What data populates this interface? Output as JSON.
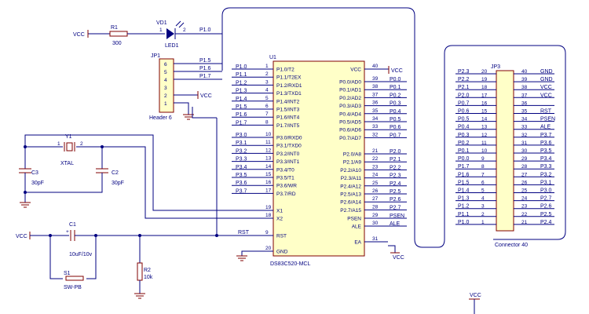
{
  "u1": {
    "ref": "U1",
    "name": "DS83C520-MCL",
    "left_pins": [
      {
        "num": "1",
        "name": "P1.0/T2",
        "net": "P1.0"
      },
      {
        "num": "2",
        "name": "P1.1/T2EX",
        "net": "P1.1"
      },
      {
        "num": "3",
        "name": "P1.2/RXD1",
        "net": "P1.2"
      },
      {
        "num": "4",
        "name": "P1.3/TXD1",
        "net": "P1.3"
      },
      {
        "num": "5",
        "name": "P1.4/INT2",
        "net": "P1.4"
      },
      {
        "num": "6",
        "name": "P1.5/INT3",
        "net": "P1.5"
      },
      {
        "num": "7",
        "name": "P1.6/INT4",
        "net": "P1.6"
      },
      {
        "num": "8",
        "name": "P1.7/INT5",
        "net": "P1.7"
      },
      {
        "num": "10",
        "name": "P3.0/RXD0",
        "net": "P3.0"
      },
      {
        "num": "11",
        "name": "P3.1/TXD0",
        "net": "P3.1"
      },
      {
        "num": "12",
        "name": "P3.2/INT0",
        "net": "P3.2"
      },
      {
        "num": "13",
        "name": "P3.3/INT1",
        "net": "P3.3"
      },
      {
        "num": "14",
        "name": "P3.4/T0",
        "net": "P3.4"
      },
      {
        "num": "15",
        "name": "P3.5/T1",
        "net": "P3.5"
      },
      {
        "num": "16",
        "name": "P3.6/WR",
        "net": "P3.6"
      },
      {
        "num": "17",
        "name": "P3.7/RD",
        "net": "P3.7"
      },
      {
        "num": "19",
        "name": "X1",
        "net": ""
      },
      {
        "num": "18",
        "name": "X2",
        "net": ""
      },
      {
        "num": "9",
        "name": "RST",
        "net": "RST"
      },
      {
        "num": "20",
        "name": "GND",
        "net": ""
      }
    ],
    "right_pins": [
      {
        "num": "40",
        "name": "VCC",
        "net": "VCC"
      },
      {
        "num": "39",
        "name": "P0.0/AD0",
        "net": "P0.0"
      },
      {
        "num": "38",
        "name": "P0.1/AD1",
        "net": "P0.1"
      },
      {
        "num": "37",
        "name": "P0.2/AD2",
        "net": "P0.2"
      },
      {
        "num": "36",
        "name": "P0.3/AD3",
        "net": "P0.3"
      },
      {
        "num": "35",
        "name": "P0.4/AD4",
        "net": "P0.4"
      },
      {
        "num": "34",
        "name": "P0.5/AD5",
        "net": "P0.5"
      },
      {
        "num": "33",
        "name": "P0.6/AD6",
        "net": "P0.6"
      },
      {
        "num": "32",
        "name": "P0.7/AD7",
        "net": "P0.7"
      },
      {
        "num": "21",
        "name": "P2.0/A8",
        "net": "P2.0"
      },
      {
        "num": "22",
        "name": "P2.1/A9",
        "net": "P2.1"
      },
      {
        "num": "23",
        "name": "P2.2/A10",
        "net": "P2.2"
      },
      {
        "num": "24",
        "name": "P2.3/A11",
        "net": "P2.3"
      },
      {
        "num": "25",
        "name": "P2.4/A12",
        "net": "P2.4"
      },
      {
        "num": "26",
        "name": "P2.5/A13",
        "net": "P2.5"
      },
      {
        "num": "27",
        "name": "P2.6/A14",
        "net": "P2.6"
      },
      {
        "num": "28",
        "name": "P2.7/A15",
        "net": "P2.7"
      },
      {
        "num": "29",
        "name": "PSEN",
        "net": "PSEN"
      },
      {
        "num": "30",
        "name": "ALE",
        "net": "ALE"
      },
      {
        "num": "31",
        "name": "EA",
        "net": "VCC"
      }
    ]
  },
  "jp3": {
    "ref": "JP3",
    "name": "Connector 40",
    "rows": [
      {
        "ln": "P2.3",
        "lp": "20",
        "rp": "40",
        "rn": "GND"
      },
      {
        "ln": "P2.2",
        "lp": "19",
        "rp": "39",
        "rn": "GND"
      },
      {
        "ln": "P2.1",
        "lp": "18",
        "rp": "38",
        "rn": "VCC"
      },
      {
        "ln": "P2.0",
        "lp": "17",
        "rp": "37",
        "rn": "VCC"
      },
      {
        "ln": "P0.7",
        "lp": "16",
        "rp": "36",
        "rn": ""
      },
      {
        "ln": "P0.6",
        "lp": "15",
        "rp": "35",
        "rn": "RST"
      },
      {
        "ln": "P0.5",
        "lp": "14",
        "rp": "34",
        "rn": "PSEN"
      },
      {
        "ln": "P0.4",
        "lp": "13",
        "rp": "33",
        "rn": "ALE"
      },
      {
        "ln": "P0.3",
        "lp": "12",
        "rp": "32",
        "rn": "P3.7"
      },
      {
        "ln": "P0.2",
        "lp": "11",
        "rp": "31",
        "rn": "P3.6"
      },
      {
        "ln": "P0.1",
        "lp": "10",
        "rp": "30",
        "rn": "P3.5"
      },
      {
        "ln": "P0.0",
        "lp": "9",
        "rp": "29",
        "rn": "P3.4"
      },
      {
        "ln": "P1.7",
        "lp": "8",
        "rp": "28",
        "rn": "P3.3"
      },
      {
        "ln": "P1.6",
        "lp": "7",
        "rp": "27",
        "rn": "P3.2"
      },
      {
        "ln": "P1.5",
        "lp": "6",
        "rp": "26",
        "rn": "P3.1"
      },
      {
        "ln": "P1.4",
        "lp": "5",
        "rp": "25",
        "rn": "P3.0"
      },
      {
        "ln": "P1.3",
        "lp": "4",
        "rp": "24",
        "rn": "P2.7"
      },
      {
        "ln": "P1.2",
        "lp": "3",
        "rp": "23",
        "rn": "P2.6"
      },
      {
        "ln": "P1.1",
        "lp": "2",
        "rp": "22",
        "rn": "P2.5"
      },
      {
        "ln": "P1.0",
        "lp": "1",
        "rp": "21",
        "rn": "P2.4"
      }
    ]
  },
  "jp1": {
    "ref": "JP1",
    "name": "Header 6",
    "pins": [
      "6",
      "5",
      "4",
      "3",
      "2",
      "1"
    ],
    "nets": [
      "P1.5",
      "P1.6",
      "P1.7"
    ],
    "vcc": "VCC"
  },
  "led": {
    "ref": "VD1",
    "name": "LED1",
    "pin1": "1",
    "pin2": "2",
    "net": "P1.0"
  },
  "r1": {
    "ref": "R1",
    "value": "300",
    "vcc": "VCC"
  },
  "y1": {
    "ref": "Y1",
    "name": "XTAL",
    "pin1": "1",
    "pin2": "2"
  },
  "c3": {
    "ref": "C3",
    "value": "30pF"
  },
  "c2": {
    "ref": "C2",
    "value": "30pF"
  },
  "c1": {
    "ref": "C1",
    "value": "10uF/10v",
    "vcc": "VCC"
  },
  "r2": {
    "ref": "R2",
    "value": "10k"
  },
  "s1": {
    "ref": "S1",
    "name": "SW-PB"
  },
  "u1_vcc": "VCC",
  "ea_vcc": "VCC",
  "bottom_vcc": "VCC",
  "rst_net": "RST"
}
